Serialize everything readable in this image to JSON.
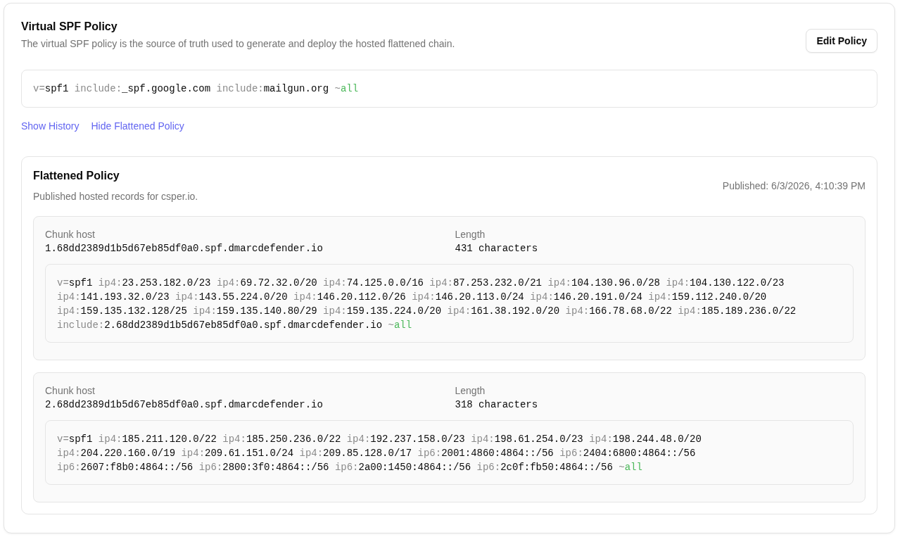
{
  "policy": {
    "title": "Virtual SPF Policy",
    "description": "The virtual SPF policy is the source of truth used to generate and deploy the hosted flattened chain.",
    "edit_button": "Edit Policy",
    "record": [
      {
        "kind": "version",
        "key": "v=",
        "value": "spf1"
      },
      {
        "kind": "mechanism",
        "key": "include:",
        "value": "_spf.google.com"
      },
      {
        "kind": "mechanism",
        "key": "include:",
        "value": "mailgun.org"
      },
      {
        "kind": "all",
        "key": "~",
        "value": "all"
      }
    ]
  },
  "links": [
    "Show History",
    "Hide Flattened Policy"
  ],
  "flattened": {
    "title": "Flattened Policy",
    "description": "Published hosted records for csper.io.",
    "published": "Published: 6/3/2026, 4:10:39 PM",
    "chunks": [
      {
        "host_label": "Chunk host",
        "host": "1.68dd2389d1b5d67eb85df0a0.spf.dmarcdefender.io",
        "length_label": "Length",
        "length": "431 characters",
        "record": [
          {
            "kind": "version",
            "key": "v=",
            "value": "spf1"
          },
          {
            "kind": "mechanism",
            "key": "ip4:",
            "value": "23.253.182.0/23"
          },
          {
            "kind": "mechanism",
            "key": "ip4:",
            "value": "69.72.32.0/20"
          },
          {
            "kind": "mechanism",
            "key": "ip4:",
            "value": "74.125.0.0/16"
          },
          {
            "kind": "mechanism",
            "key": "ip4:",
            "value": "87.253.232.0/21"
          },
          {
            "kind": "mechanism",
            "key": "ip4:",
            "value": "104.130.96.0/28"
          },
          {
            "kind": "mechanism",
            "key": "ip4:",
            "value": "104.130.122.0/23"
          },
          {
            "kind": "mechanism",
            "key": "ip4:",
            "value": "141.193.32.0/23"
          },
          {
            "kind": "mechanism",
            "key": "ip4:",
            "value": "143.55.224.0/20"
          },
          {
            "kind": "mechanism",
            "key": "ip4:",
            "value": "146.20.112.0/26"
          },
          {
            "kind": "mechanism",
            "key": "ip4:",
            "value": "146.20.113.0/24"
          },
          {
            "kind": "mechanism",
            "key": "ip4:",
            "value": "146.20.191.0/24"
          },
          {
            "kind": "mechanism",
            "key": "ip4:",
            "value": "159.112.240.0/20"
          },
          {
            "kind": "mechanism",
            "key": "ip4:",
            "value": "159.135.132.128/25"
          },
          {
            "kind": "mechanism",
            "key": "ip4:",
            "value": "159.135.140.80/29"
          },
          {
            "kind": "mechanism",
            "key": "ip4:",
            "value": "159.135.224.0/20"
          },
          {
            "kind": "mechanism",
            "key": "ip4:",
            "value": "161.38.192.0/20"
          },
          {
            "kind": "mechanism",
            "key": "ip4:",
            "value": "166.78.68.0/22"
          },
          {
            "kind": "mechanism",
            "key": "ip4:",
            "value": "185.189.236.0/22"
          },
          {
            "kind": "mechanism",
            "key": "include:",
            "value": "2.68dd2389d1b5d67eb85df0a0.spf.dmarcdefender.io"
          },
          {
            "kind": "all",
            "key": "~",
            "value": "all"
          }
        ]
      },
      {
        "host_label": "Chunk host",
        "host": "2.68dd2389d1b5d67eb85df0a0.spf.dmarcdefender.io",
        "length_label": "Length",
        "length": "318 characters",
        "record": [
          {
            "kind": "version",
            "key": "v=",
            "value": "spf1"
          },
          {
            "kind": "mechanism",
            "key": "ip4:",
            "value": "185.211.120.0/22"
          },
          {
            "kind": "mechanism",
            "key": "ip4:",
            "value": "185.250.236.0/22"
          },
          {
            "kind": "mechanism",
            "key": "ip4:",
            "value": "192.237.158.0/23"
          },
          {
            "kind": "mechanism",
            "key": "ip4:",
            "value": "198.61.254.0/23"
          },
          {
            "kind": "mechanism",
            "key": "ip4:",
            "value": "198.244.48.0/20"
          },
          {
            "kind": "mechanism",
            "key": "ip4:",
            "value": "204.220.160.0/19"
          },
          {
            "kind": "mechanism",
            "key": "ip4:",
            "value": "209.61.151.0/24"
          },
          {
            "kind": "mechanism",
            "key": "ip4:",
            "value": "209.85.128.0/17"
          },
          {
            "kind": "mechanism",
            "key": "ip6:",
            "value": "2001:4860:4864::/56"
          },
          {
            "kind": "mechanism",
            "key": "ip6:",
            "value": "2404:6800:4864::/56"
          },
          {
            "kind": "mechanism",
            "key": "ip6:",
            "value": "2607:f8b0:4864::/56"
          },
          {
            "kind": "mechanism",
            "key": "ip6:",
            "value": "2800:3f0:4864::/56"
          },
          {
            "kind": "mechanism",
            "key": "ip6:",
            "value": "2a00:1450:4864::/56"
          },
          {
            "kind": "mechanism",
            "key": "ip6:",
            "value": "2c0f:fb50:4864::/56"
          },
          {
            "kind": "all",
            "key": "~",
            "value": "all"
          }
        ]
      }
    ]
  }
}
